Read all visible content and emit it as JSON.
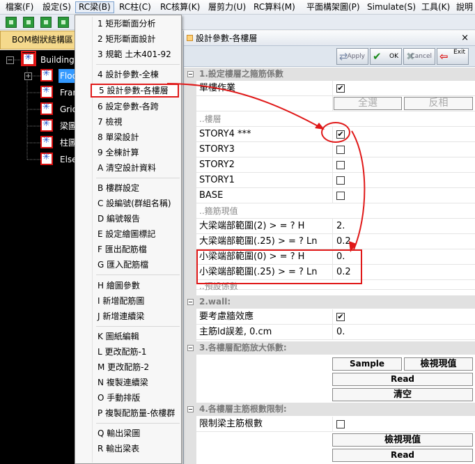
{
  "menubar": {
    "items": [
      "檔案(F)",
      "設定(S)",
      "RC梁(B)",
      "RC柱(C)",
      "RC核算(K)",
      "層剪力(U)",
      "RC算料(M)",
      "平面構架圖(P)",
      "Simulate(S)",
      "工具(K)",
      "說明"
    ]
  },
  "tree": {
    "tab_label": "BOM樹狀結構區",
    "nodes": [
      "Building",
      "Floor",
      "Frame",
      "Grid",
      "梁圖",
      "柱圖",
      "Else"
    ]
  },
  "menu": {
    "items": [
      "1 矩形斷面分析",
      "2 矩形斷面設計",
      "3 規範 土木401-92",
      "4 設計參數-全棟",
      "5 設計參數-各樓層",
      "6 設定參數-各跨",
      "7 檢視",
      "8 單梁設計",
      "9 全棟計算",
      "A 清空設計資料",
      "B 樓群設定",
      "C 設編號(群組名稱)",
      "D 編號報告",
      "E 設定繪圖標記",
      "F 匯出配筋檔",
      "G 匯入配筋檔",
      "H 繪圖參數",
      "I 新增配筋圖",
      "J 新增連續梁",
      "K 圖紙編輯",
      "L 更改配筋-1",
      "M 更改配筋-2",
      "N 複製連續梁",
      "O 手動排版",
      "P 複製配筋量-依樓群",
      "Q 輸出梁圖",
      "R 輸出梁表"
    ]
  },
  "dialog": {
    "title": "設計參數-各樓層",
    "close": "×",
    "buttons": {
      "apply": "Apply",
      "ok": "OK",
      "cancel": "Cancel",
      "exit": "Exit"
    }
  },
  "grid": {
    "cat1": "1.設定樓層之箍筋係數",
    "single_story": "單樓作業",
    "select_all": "全選",
    "invert": "反相",
    "floors_label": "..樓層",
    "story4": "STORY4 ***",
    "story3": "STORY3",
    "story2": "STORY2",
    "story1": "STORY1",
    "base": "BASE",
    "stirrup_label": "..箍筋現值",
    "p1_label": "大梁端部範圍(2) > = ? H",
    "p1_value": "2.",
    "p2_label": "大梁端部範圍(.25) > = ? Ln",
    "p2_value": "0.2",
    "p3_label": "小梁端部範圍(0) > = ? H",
    "p3_value": "0.",
    "p4_label": "小梁端部範圍(.25) > = ? Ln",
    "p4_value": "0.2",
    "preset_label": "..預設係數",
    "cat2": "2.wall:",
    "wall_effect": "要考慮牆效應",
    "ld_error": "主筋ld誤差, 0.cm",
    "ld_value": "0.",
    "cat3": "3.各樓層配筋放大係數:",
    "sample": "Sample",
    "view_current": "檢視現值",
    "read": "Read",
    "clear": "清空",
    "cat4": "4.各樓層主筋根數限制:",
    "limit_bars": "限制梁主筋根數",
    "view_current2": "檢視現值",
    "read2": "Read"
  },
  "colors": {
    "annotation": "#e01818",
    "accent": "#3399ff"
  }
}
